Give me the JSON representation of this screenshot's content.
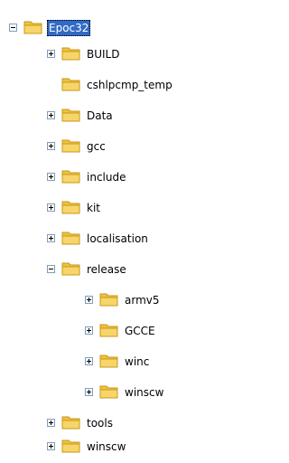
{
  "tree": {
    "root": {
      "label": "Epoc32",
      "state": "expanded",
      "selected": true
    },
    "children": [
      {
        "label": "BUILD",
        "state": "collapsed"
      },
      {
        "label": "cshlpcmp_temp",
        "state": "leaf"
      },
      {
        "label": "Data",
        "state": "collapsed"
      },
      {
        "label": "gcc",
        "state": "collapsed"
      },
      {
        "label": "include",
        "state": "collapsed"
      },
      {
        "label": "kit",
        "state": "collapsed"
      },
      {
        "label": "localisation",
        "state": "collapsed"
      },
      {
        "label": "release",
        "state": "expanded",
        "children": [
          {
            "label": "armv5",
            "state": "collapsed"
          },
          {
            "label": "GCCE",
            "state": "collapsed"
          },
          {
            "label": "winc",
            "state": "collapsed"
          },
          {
            "label": "winscw",
            "state": "collapsed"
          }
        ]
      },
      {
        "label": "tools",
        "state": "collapsed"
      },
      {
        "label": "winscw",
        "state": "collapsed"
      }
    ]
  },
  "icons": {
    "folder": "folder-icon",
    "expand": "expand-icon",
    "collapse": "collapse-icon"
  },
  "colors": {
    "folder_fill": "#f7d56a",
    "folder_tab": "#f0c040",
    "folder_outline": "#c79a17",
    "selection": "#316ac5",
    "toggle_border": "#7f9db9"
  }
}
